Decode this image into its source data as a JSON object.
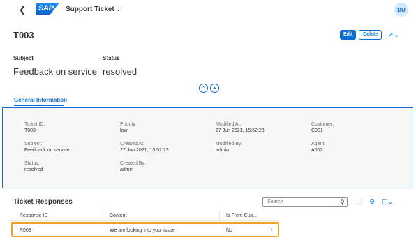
{
  "shell": {
    "logo_text": "SAP",
    "app_title": "Support Ticket",
    "avatar_initials": "DU"
  },
  "object": {
    "title": "T003",
    "actions": {
      "edit": "Edit",
      "delete": "Delete"
    }
  },
  "header": {
    "subject_label": "Subject",
    "subject_value": "Feedback on service",
    "status_label": "Status",
    "status_value": "resolved"
  },
  "tabs": [
    {
      "label": "General Information"
    }
  ],
  "general": {
    "ticket_id": {
      "label": "Ticket ID:",
      "value": "T003"
    },
    "priority": {
      "label": "Priority:",
      "value": "low"
    },
    "modified_at": {
      "label": "Modified At:",
      "value": "27 Jun 2021, 15:52:23"
    },
    "customer": {
      "label": "Customer:",
      "value": "C001"
    },
    "subject": {
      "label": "Subject:",
      "value": "Feedback on service"
    },
    "created_at": {
      "label": "Created At:",
      "value": "27 Jun 2021, 15:52:23"
    },
    "modified_by": {
      "label": "Modified By:",
      "value": "admin"
    },
    "agent": {
      "label": "Agent:",
      "value": "A002"
    },
    "status": {
      "label": "Status:",
      "value": "resolved"
    },
    "created_by": {
      "label": "Created By:",
      "value": "admin"
    }
  },
  "responses": {
    "title": "Ticket Responses",
    "search_placeholder": "Search",
    "columns": [
      "Response ID",
      "Content",
      "Is From Cus..."
    ],
    "rows": [
      {
        "id": "R003",
        "content": "We are looking into your issue",
        "from_customer": "No"
      }
    ]
  },
  "colors": {
    "accent": "#0a6ed1",
    "focus": "#f0a31e"
  }
}
